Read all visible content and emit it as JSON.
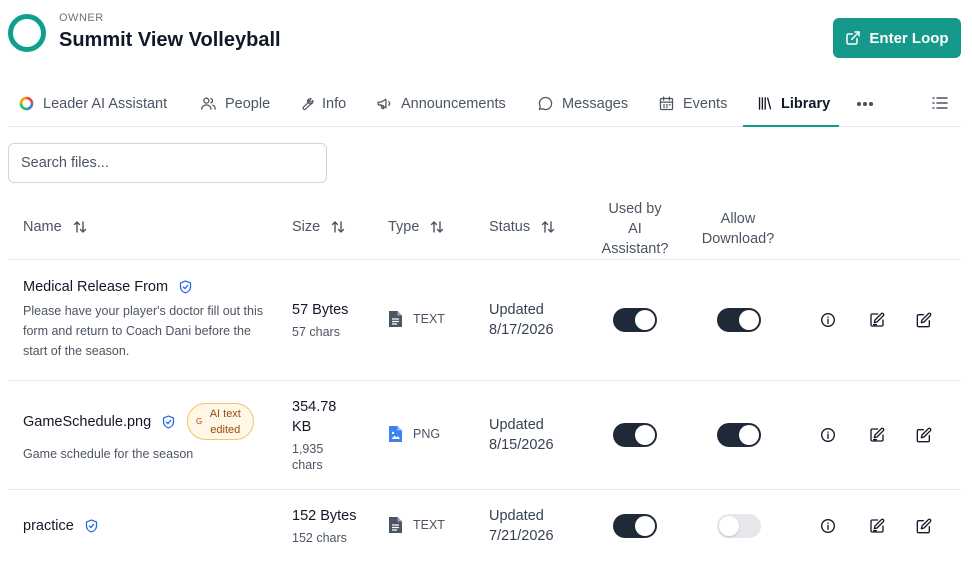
{
  "header": {
    "owner_label": "OWNER",
    "org_name": "Summit View Volleyball",
    "enter_button": "Enter Loop",
    "brand_color": "#15998a"
  },
  "tabs": [
    {
      "label": "Leader AI Assistant",
      "icon": "ai-assistant-icon"
    },
    {
      "label": "People",
      "icon": "people-icon"
    },
    {
      "label": "Info",
      "icon": "wrench-icon"
    },
    {
      "label": "Announcements",
      "icon": "megaphone-icon"
    },
    {
      "label": "Messages",
      "icon": "chat-bubble-icon"
    },
    {
      "label": "Events",
      "icon": "calendar-icon"
    },
    {
      "label": "Library",
      "icon": "library-icon",
      "active": true
    }
  ],
  "search": {
    "placeholder": "Search files..."
  },
  "columns": {
    "name": "Name",
    "size": "Size",
    "type": "Type",
    "status": "Status",
    "used_by_ai": [
      "Used by",
      "AI",
      "Assistant?"
    ],
    "allow_download": [
      "Allow",
      "Download?"
    ]
  },
  "files": [
    {
      "name": "Medical Release From",
      "description": "Please have your player's doctor fill out this form and return to Coach Dani before the start of the season.",
      "size": "57 Bytes",
      "chars": "57 chars",
      "type": "TEXT",
      "status_line1": "Updated",
      "status_line2": "8/17/2026",
      "used_by_ai": true,
      "allow_download": true
    },
    {
      "name": "GameSchedule.png",
      "badge": "AI text edited",
      "description": "Game schedule for the season",
      "size_line1": "354.78",
      "size_line2": "KB",
      "chars_line1": "1,935",
      "chars_line2": "chars",
      "type": "PNG",
      "status_line1": "Updated",
      "status_line2": "8/15/2026",
      "used_by_ai": true,
      "allow_download": true
    },
    {
      "name": "practice",
      "description": "",
      "size": "152 Bytes",
      "chars": "152 chars",
      "type": "TEXT",
      "status_line1": "Updated",
      "status_line2": "7/21/2026",
      "used_by_ai": true,
      "allow_download": false
    }
  ]
}
